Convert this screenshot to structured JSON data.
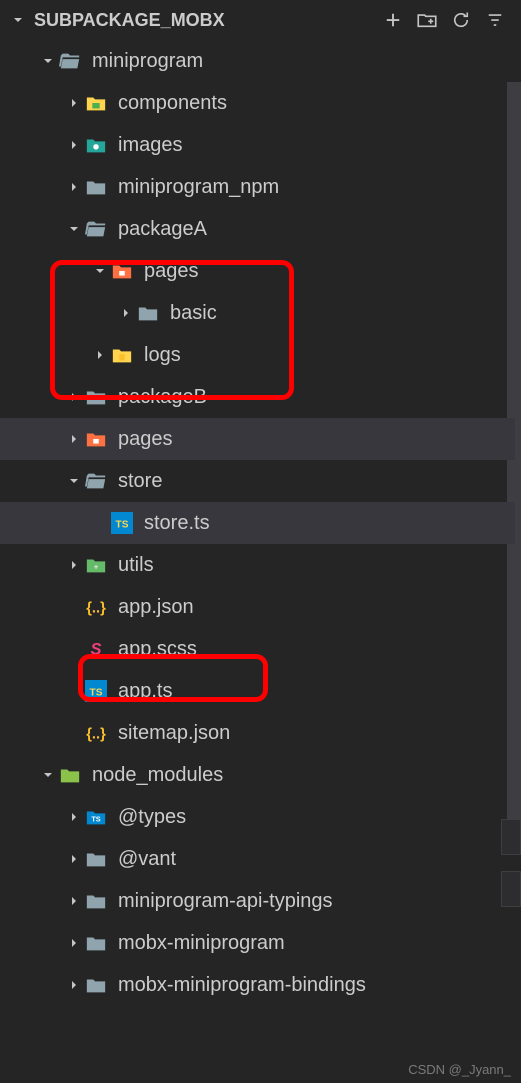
{
  "header": {
    "title": "SUBPACKAGE_MOBX"
  },
  "tree": {
    "root": "miniprogram",
    "items": [
      {
        "label": "components",
        "indent": 2,
        "icon": "folder-green",
        "chev": "right"
      },
      {
        "label": "images",
        "indent": 2,
        "icon": "folder-teal",
        "chev": "right"
      },
      {
        "label": "miniprogram_npm",
        "indent": 2,
        "icon": "folder-grey",
        "chev": "right"
      },
      {
        "label": "packageA",
        "indent": 2,
        "icon": "folder-open",
        "chev": "down"
      },
      {
        "label": "pages",
        "indent": 3,
        "icon": "folder-orange",
        "chev": "down"
      },
      {
        "label": "basic",
        "indent": 4,
        "icon": "folder-grey",
        "chev": "right"
      },
      {
        "label": "logs",
        "indent": 3,
        "icon": "folder-yellow",
        "chev": "right"
      },
      {
        "label": "packageB",
        "indent": 2,
        "icon": "folder-grey",
        "chev": "right"
      },
      {
        "label": "pages",
        "indent": 2,
        "icon": "folder-orange",
        "chev": "right",
        "selected": true
      },
      {
        "label": "store",
        "indent": 2,
        "icon": "folder-open",
        "chev": "down"
      },
      {
        "label": "store.ts",
        "indent": 3,
        "icon": "ts",
        "chev": "blank",
        "selected": true
      },
      {
        "label": "utils",
        "indent": 2,
        "icon": "folder-green2",
        "chev": "right"
      },
      {
        "label": "app.json",
        "indent": 2,
        "icon": "json",
        "chev": "blank"
      },
      {
        "label": "app.scss",
        "indent": 2,
        "icon": "scss",
        "chev": "blank"
      },
      {
        "label": "app.ts",
        "indent": 2,
        "icon": "ts",
        "chev": "blank"
      },
      {
        "label": "sitemap.json",
        "indent": 2,
        "icon": "json",
        "chev": "blank"
      }
    ],
    "node_modules": "node_modules",
    "nm_items": [
      {
        "label": "@types",
        "indent": 2,
        "icon": "ts-folder",
        "chev": "right"
      },
      {
        "label": "@vant",
        "indent": 2,
        "icon": "folder-grey",
        "chev": "right"
      },
      {
        "label": "miniprogram-api-typings",
        "indent": 2,
        "icon": "folder-grey",
        "chev": "right"
      },
      {
        "label": "mobx-miniprogram",
        "indent": 2,
        "icon": "folder-grey",
        "chev": "right"
      },
      {
        "label": "mobx-miniprogram-bindings",
        "indent": 2,
        "icon": "folder-grey",
        "chev": "right"
      }
    ]
  },
  "watermark": "CSDN @_Jyann_"
}
